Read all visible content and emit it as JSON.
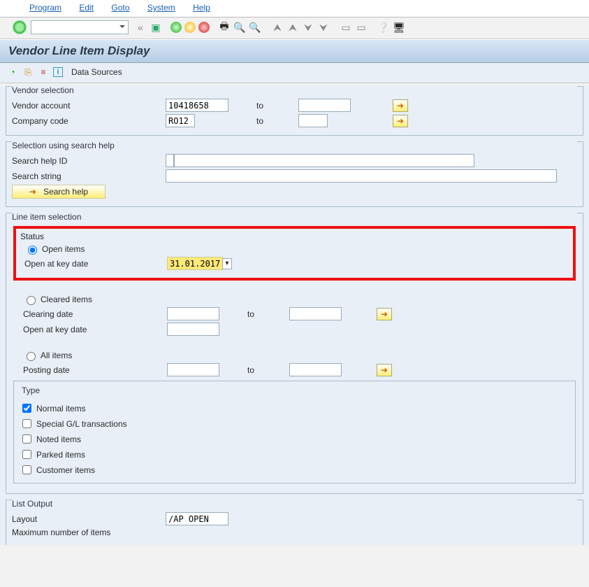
{
  "menu": {
    "program": "Program",
    "edit": "Edit",
    "goto": "Goto",
    "system": "System",
    "help": "Help"
  },
  "title": "Vendor Line Item Display",
  "datasources_label": "Data Sources",
  "groups": {
    "vendor_selection": {
      "legend": "Vendor selection",
      "vendor_account": {
        "label": "Vendor account",
        "value": "10418658",
        "to": "to"
      },
      "company_code": {
        "label": "Company code",
        "value": "RO12",
        "to": "to"
      }
    },
    "search_help": {
      "legend": "Selection using search help",
      "id_label": "Search help ID",
      "string_label": "Search string",
      "btn": "Search help"
    },
    "line_item": {
      "legend": "Line item selection",
      "status_legend": "Status",
      "open_items": "Open items",
      "open_keydate": "Open at key date",
      "open_keydate_value": "31.01.2017",
      "cleared": "Cleared items",
      "clearing_date": "Clearing date",
      "clearing_to": "to",
      "cleared_keydate": "Open at key date",
      "all": "All items",
      "posting_date": "Posting date",
      "posting_to": "to",
      "type_legend": "Type",
      "normal": "Normal items",
      "special": "Special G/L transactions",
      "noted": "Noted items",
      "parked": "Parked items",
      "customer": "Customer items"
    },
    "list_output": {
      "legend": "List Output",
      "layout": {
        "label": "Layout",
        "value": "/AP OPEN"
      },
      "max": "Maximum number of items"
    }
  }
}
